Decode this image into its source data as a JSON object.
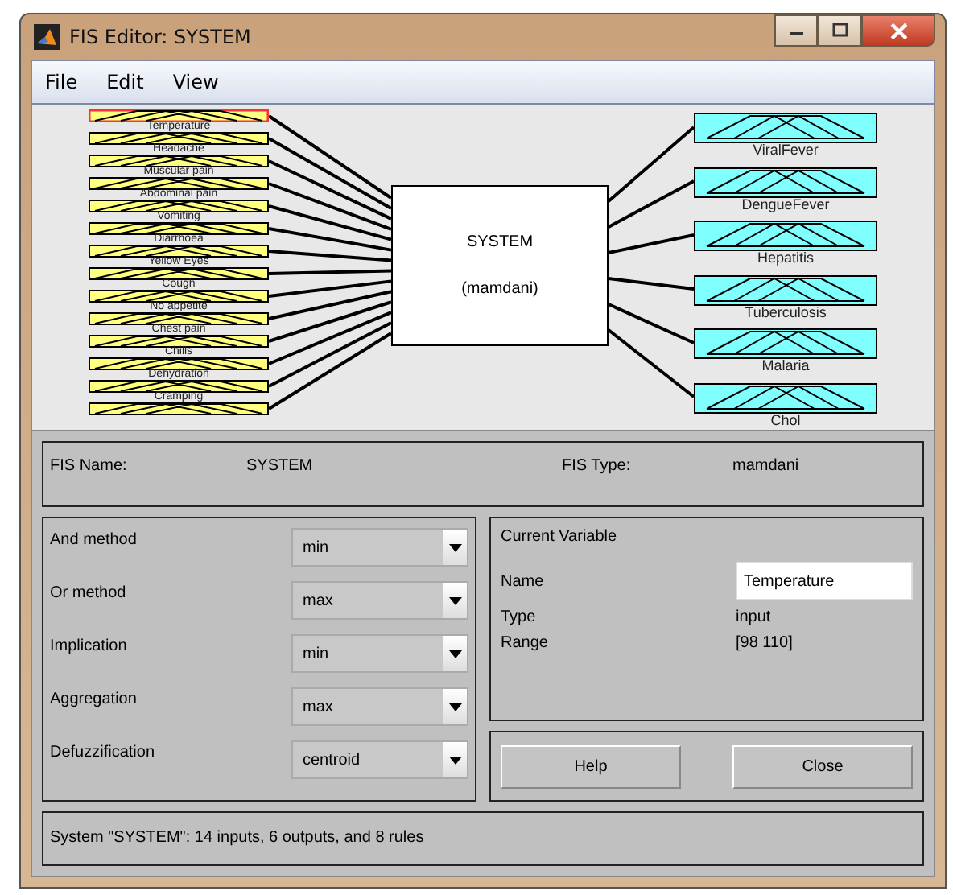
{
  "window": {
    "title": "FIS Editor: SYSTEM"
  },
  "menu": [
    "File",
    "Edit",
    "View"
  ],
  "diagram": {
    "inputs": [
      {
        "name": "Temperature",
        "selected": true
      },
      {
        "name": "Headache",
        "selected": false
      },
      {
        "name": "Muscular pain",
        "selected": false
      },
      {
        "name": "Abdominal pain",
        "selected": false
      },
      {
        "name": "Vomiting",
        "selected": false
      },
      {
        "name": "Diarrhoea",
        "selected": false
      },
      {
        "name": "Yellow Eyes",
        "selected": false
      },
      {
        "name": "Cough",
        "selected": false
      },
      {
        "name": "No appetite",
        "selected": false
      },
      {
        "name": "Chest pain",
        "selected": false
      },
      {
        "name": "Chills",
        "selected": false
      },
      {
        "name": "Dehydration",
        "selected": false
      },
      {
        "name": "Cramping",
        "selected": false
      },
      {
        "selected": false
      }
    ],
    "system": {
      "name": "SYSTEM",
      "type": "(mamdani)"
    },
    "outputs": [
      {
        "name": "ViralFever",
        "selected": false
      },
      {
        "name": "DengueFever",
        "selected": false
      },
      {
        "name": "Hepatitis",
        "selected": false
      },
      {
        "name": "Tuberculosis",
        "selected": false
      },
      {
        "name": "Malaria",
        "selected": false
      },
      {
        "name": "Chol",
        "selected": false
      }
    ]
  },
  "fis": {
    "name_label": "FIS Name:",
    "name": "SYSTEM",
    "type_label": "FIS Type:",
    "type": "mamdani"
  },
  "methods": [
    {
      "label": "And method",
      "value": "min"
    },
    {
      "label": "Or method",
      "value": "max"
    },
    {
      "label": "Implication",
      "value": "min"
    },
    {
      "label": "Aggregation",
      "value": "max"
    },
    {
      "label": "Defuzzification",
      "value": "centroid"
    }
  ],
  "current_variable": {
    "title": "Current Variable",
    "name_label": "Name",
    "name": "Temperature",
    "type_label": "Type",
    "type": "input",
    "range_label": "Range",
    "range": "[98 110]"
  },
  "buttons": [
    "Help",
    "Close"
  ],
  "status": "System \"SYSTEM\": 14 inputs, 6 outputs, and 8 rules"
}
